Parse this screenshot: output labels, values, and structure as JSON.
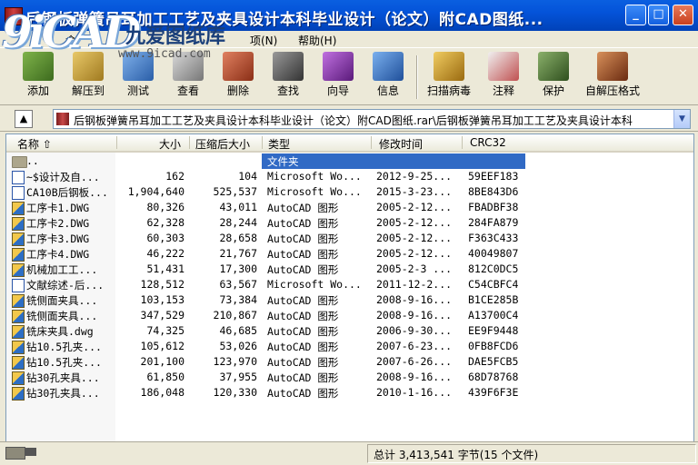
{
  "window": {
    "title": "后钢板弹簧吊耳加工工艺及夹具设计本科毕业设计（论文）附CAD图纸...",
    "minimize": "_",
    "maximize": "□",
    "close": "✕"
  },
  "watermark": {
    "logo": "9iCAD",
    "name": "九爱图纸库",
    "url": "www.9icad.com"
  },
  "menu": {
    "items": [
      {
        "label": "命"
      },
      {
        "label": "项(N)"
      },
      {
        "label": "帮助(H)"
      }
    ]
  },
  "toolbar": {
    "items": [
      {
        "label": "添加",
        "icon": "add-archive-icon",
        "color": "#5a8a2e"
      },
      {
        "label": "解压到",
        "icon": "extract-to-icon",
        "color": "#c9a23a"
      },
      {
        "label": "测试",
        "icon": "test-icon",
        "color": "#3e7cc7"
      },
      {
        "label": "查看",
        "icon": "view-icon",
        "color": "#8a8a8a"
      },
      {
        "label": "删除",
        "icon": "delete-icon",
        "color": "#b04a2e"
      },
      {
        "label": "查找",
        "icon": "find-icon",
        "color": "#4a4a4a"
      },
      {
        "label": "向导",
        "icon": "wizard-icon",
        "color": "#8a3aa8"
      },
      {
        "label": "信息",
        "icon": "info-icon",
        "color": "#2f6fc4"
      },
      {
        "label": "扫描病毒",
        "icon": "virus-scan-icon",
        "color": "#d0a030"
      },
      {
        "label": "注释",
        "icon": "comment-icon",
        "color": "#c05050"
      },
      {
        "label": "保护",
        "icon": "protect-icon",
        "color": "#4f7a3a"
      },
      {
        "label": "自解压格式",
        "icon": "sfx-icon",
        "color": "#a0522d"
      }
    ]
  },
  "address": {
    "path": "后钢板弹簧吊耳加工工艺及夹具设计本科毕业设计（论文）附CAD图纸.rar\\后钢板弹簧吊耳加工工艺及夹具设计本科"
  },
  "columns": {
    "name": "名称",
    "size": "大小",
    "packed": "压缩后大小",
    "type": "类型",
    "modified": "修改时间",
    "crc": "CRC32"
  },
  "files": [
    {
      "name": "..",
      "size": "",
      "packed": "",
      "type": "文件夹",
      "modified": "",
      "crc": "",
      "kind": "folder"
    },
    {
      "name": "~$设计及自...",
      "size": "162",
      "packed": "104",
      "type": "Microsoft Wo...",
      "modified": "2012-9-25...",
      "crc": "59EEF183",
      "kind": "doc"
    },
    {
      "name": "CA10B后钢板...",
      "size": "1,904,640",
      "packed": "525,537",
      "type": "Microsoft Wo...",
      "modified": "2015-3-23...",
      "crc": "8BE843D6",
      "kind": "doc"
    },
    {
      "name": "工序卡1.DWG",
      "size": "80,326",
      "packed": "43,011",
      "type": "AutoCAD 图形",
      "modified": "2005-2-12...",
      "crc": "FBADBF38",
      "kind": "cad"
    },
    {
      "name": "工序卡2.DWG",
      "size": "62,328",
      "packed": "28,244",
      "type": "AutoCAD 图形",
      "modified": "2005-2-12...",
      "crc": "284FA879",
      "kind": "cad"
    },
    {
      "name": "工序卡3.DWG",
      "size": "60,303",
      "packed": "28,658",
      "type": "AutoCAD 图形",
      "modified": "2005-2-12...",
      "crc": "F363C433",
      "kind": "cad"
    },
    {
      "name": "工序卡4.DWG",
      "size": "46,222",
      "packed": "21,767",
      "type": "AutoCAD 图形",
      "modified": "2005-2-12...",
      "crc": "40049807",
      "kind": "cad"
    },
    {
      "name": "机械加工工...",
      "size": "51,431",
      "packed": "17,300",
      "type": "AutoCAD 图形",
      "modified": "2005-2-3 ...",
      "crc": "812C0DC5",
      "kind": "cad"
    },
    {
      "name": "文献综述-后...",
      "size": "128,512",
      "packed": "63,567",
      "type": "Microsoft Wo...",
      "modified": "2011-12-2...",
      "crc": "C54CBFC4",
      "kind": "doc"
    },
    {
      "name": "铣侧面夹具...",
      "size": "103,153",
      "packed": "73,384",
      "type": "AutoCAD 图形",
      "modified": "2008-9-16...",
      "crc": "B1CE285B",
      "kind": "cad"
    },
    {
      "name": "铣侧面夹具...",
      "size": "347,529",
      "packed": "210,867",
      "type": "AutoCAD 图形",
      "modified": "2008-9-16...",
      "crc": "A13700C4",
      "kind": "cad"
    },
    {
      "name": "铣床夹具.dwg",
      "size": "74,325",
      "packed": "46,685",
      "type": "AutoCAD 图形",
      "modified": "2006-9-30...",
      "crc": "EE9F9448",
      "kind": "cad"
    },
    {
      "name": "钻10.5孔夹...",
      "size": "105,612",
      "packed": "53,026",
      "type": "AutoCAD 图形",
      "modified": "2007-6-23...",
      "crc": "0FB8FCD6",
      "kind": "cad"
    },
    {
      "name": "钻10.5孔夹...",
      "size": "201,100",
      "packed": "123,970",
      "type": "AutoCAD 图形",
      "modified": "2007-6-26...",
      "crc": "DAE5FCB5",
      "kind": "cad"
    },
    {
      "name": "钻30孔夹具...",
      "size": "61,850",
      "packed": "37,955",
      "type": "AutoCAD 图形",
      "modified": "2008-9-16...",
      "crc": "68D78768",
      "kind": "cad"
    },
    {
      "name": "钻30孔夹具...",
      "size": "186,048",
      "packed": "120,330",
      "type": "AutoCAD 图形",
      "modified": "2010-1-16...",
      "crc": "439F6F3E",
      "kind": "cad"
    }
  ],
  "status": {
    "summary": "总计 3,413,541 字节(15 个文件)"
  }
}
